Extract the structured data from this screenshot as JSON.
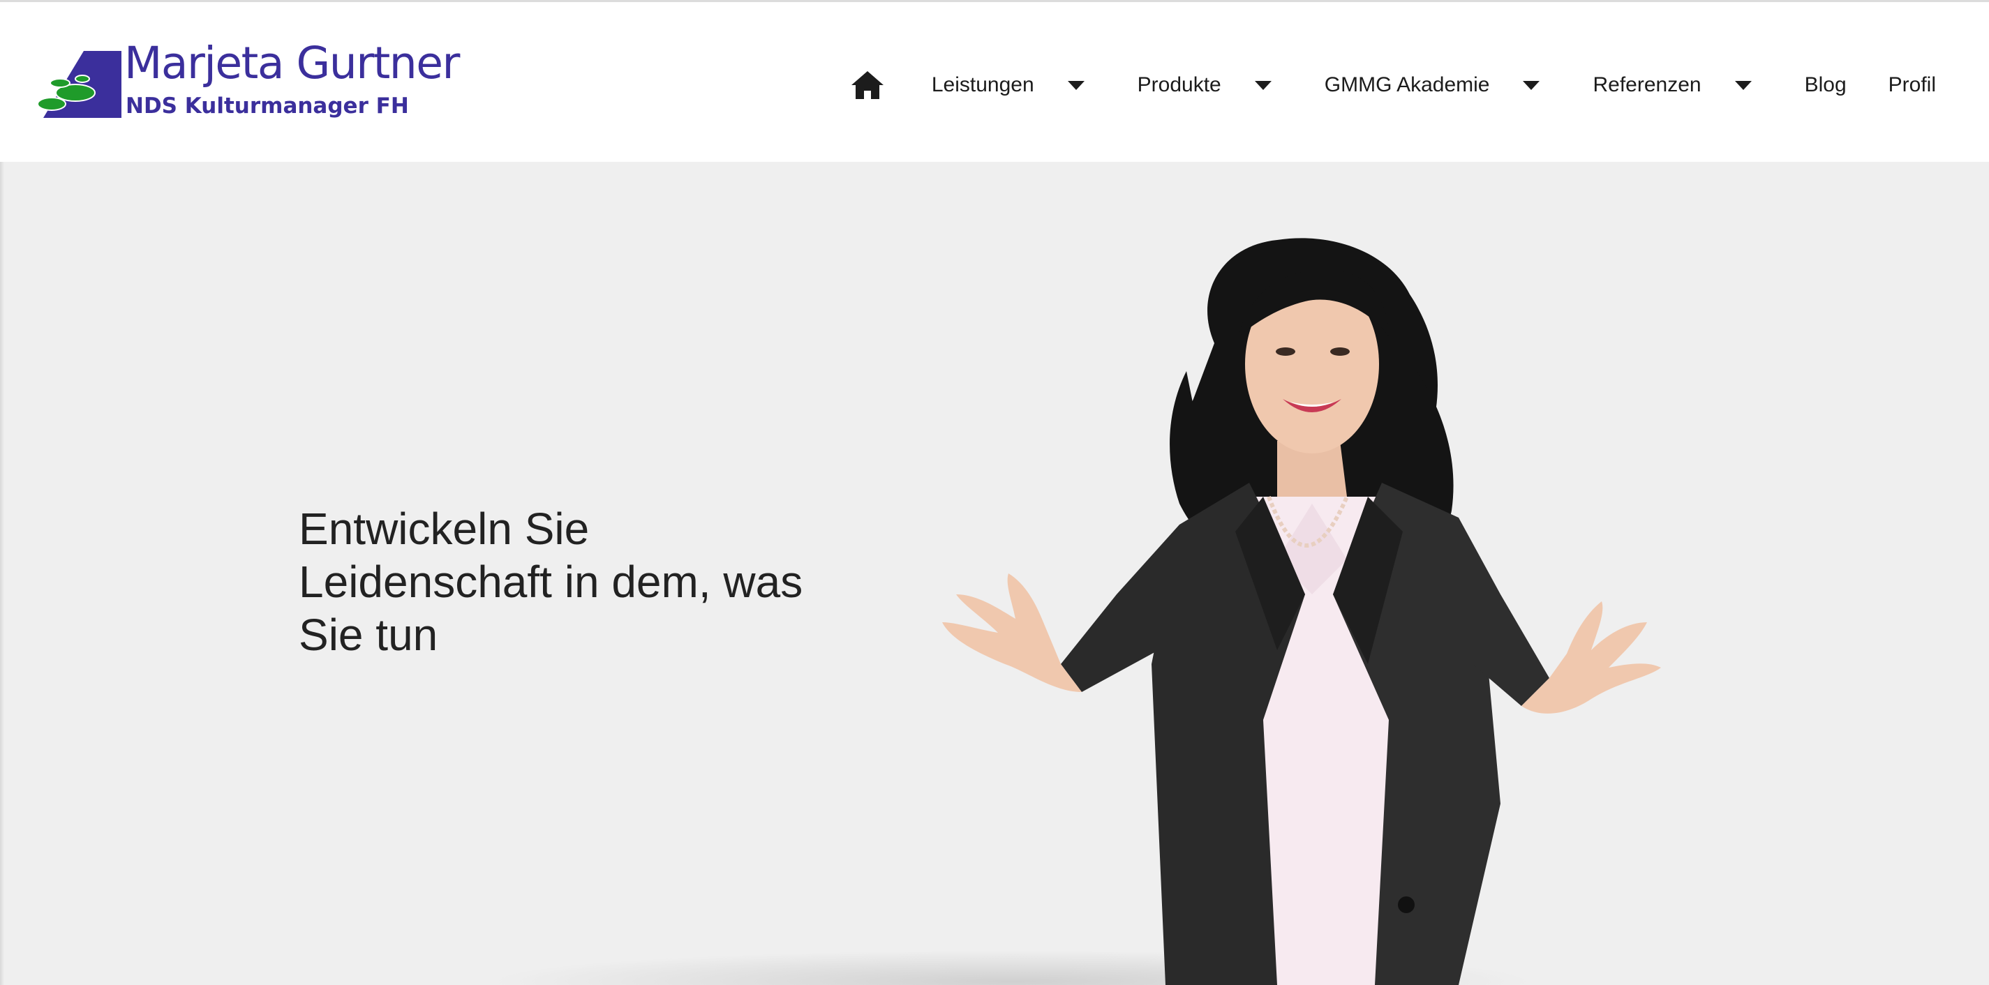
{
  "header": {
    "logo": {
      "name": "Marjeta Gurtner",
      "subtitle": "NDS Kulturmanager FH"
    },
    "nav": {
      "home_icon": "home-icon",
      "items": [
        {
          "label": "Leistungen",
          "has_dropdown": true
        },
        {
          "label": "Produkte",
          "has_dropdown": true
        },
        {
          "label": "GMMG Akademie",
          "has_dropdown": true
        },
        {
          "label": "Referenzen",
          "has_dropdown": true
        },
        {
          "label": "Blog",
          "has_dropdown": false
        },
        {
          "label": "Profil",
          "has_dropdown": false
        }
      ]
    }
  },
  "hero": {
    "heading_lines": [
      "Entwickeln Sie",
      "Leidenschaft in dem, was",
      "Sie tun"
    ]
  },
  "colors": {
    "brand_purple": "#3b2f9c",
    "lily_green": "#1f9b2a",
    "hero_background": "#efefef",
    "text": "#222222"
  }
}
